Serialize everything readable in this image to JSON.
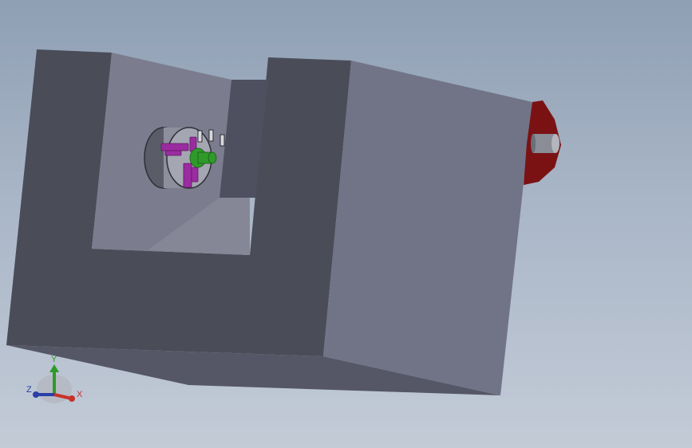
{
  "viewport": {
    "background_top": "#8f9fb4",
    "background_bottom": "#c3cbd7"
  },
  "model": {
    "body_color": "#4a4c58",
    "face_light_color": "#717487",
    "inner_color": "#7b7d8e",
    "endcap_color": "#7a1214",
    "chuck_jaw_color": "#9b2ca0",
    "spindle_color": "#2f9a2a"
  },
  "triad": {
    "x_label": "X",
    "y_label": "Y",
    "z_label": "Z",
    "x_color": "#c8322a",
    "y_color": "#2f9a2a",
    "z_color": "#2b3fa8"
  }
}
